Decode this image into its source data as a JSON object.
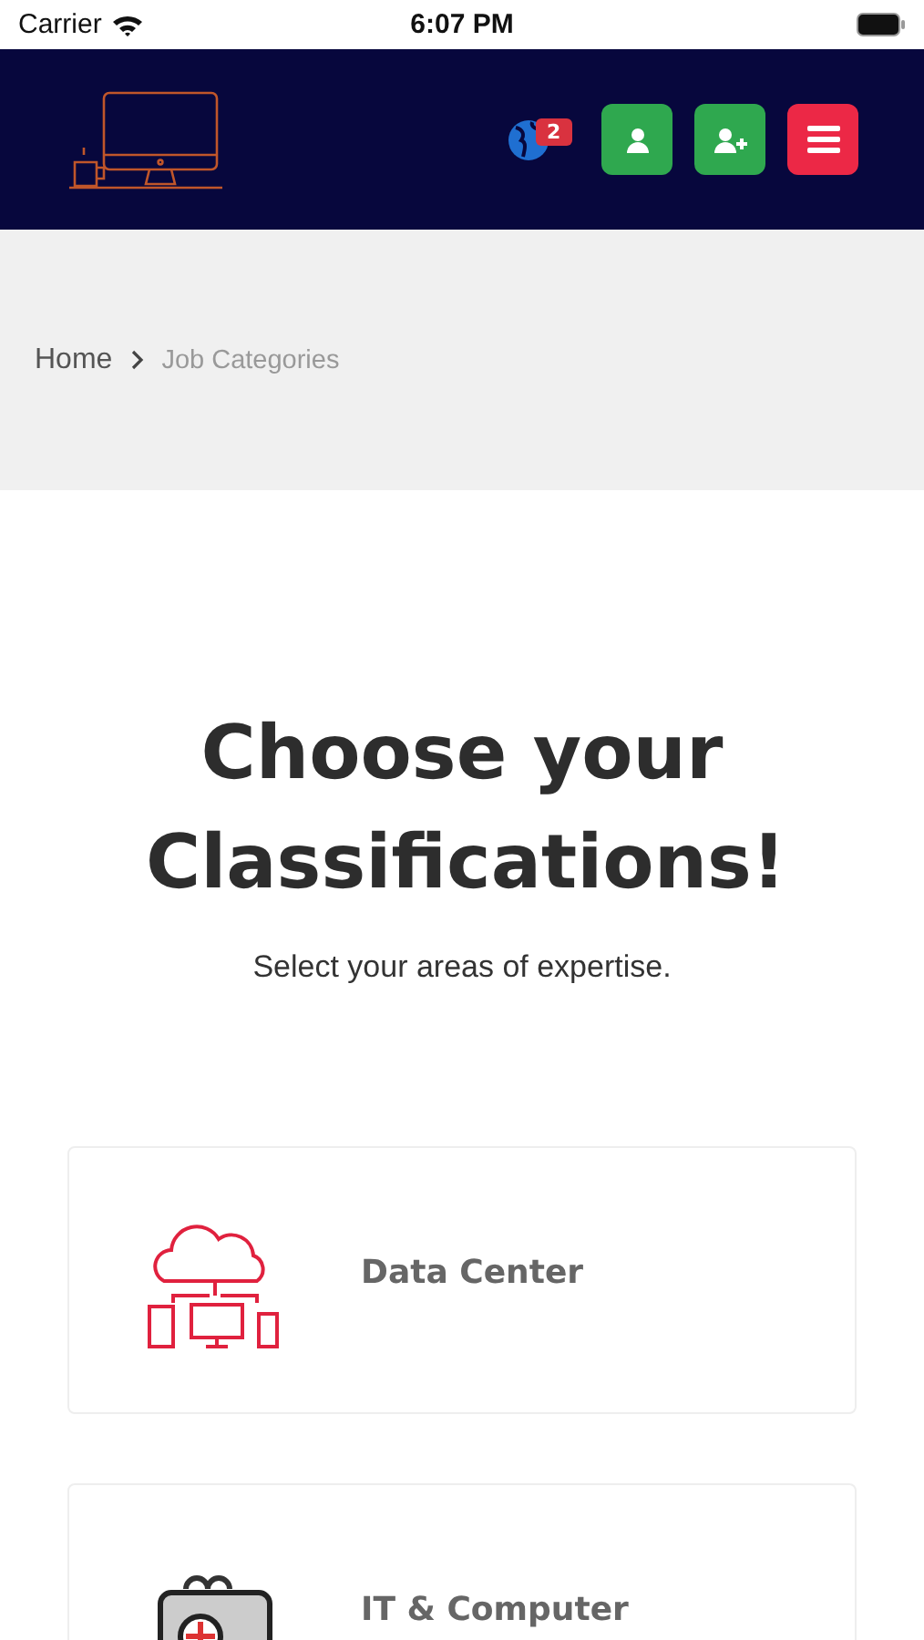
{
  "status_bar": {
    "carrier": "Carrier",
    "time": "6:07 PM"
  },
  "header": {
    "notification_count": "2"
  },
  "breadcrumb": {
    "items": [
      {
        "label": "Home",
        "selected": false
      },
      {
        "label": "Job Categories",
        "selected": true
      }
    ]
  },
  "hero": {
    "title": "Choose your Classifications!",
    "subtitle": "Select your areas of expertise."
  },
  "categories": [
    {
      "kind": "cloud",
      "label": "Data Center"
    },
    {
      "kind": "toolbox",
      "label": "IT & Computer"
    }
  ]
}
